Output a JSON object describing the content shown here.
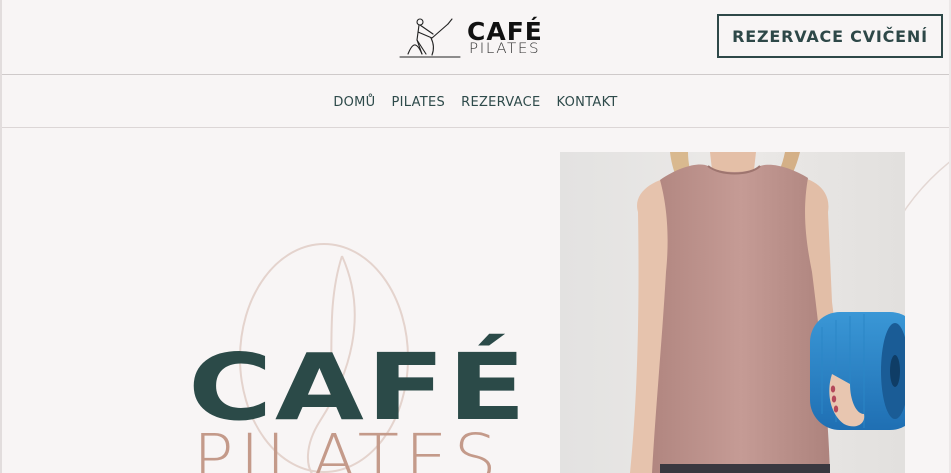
{
  "brand": {
    "name_line1": "CAFÉ",
    "name_line2": "PILATES"
  },
  "header": {
    "cta_label": "REZERVACE CVIČENÍ"
  },
  "nav": {
    "items": [
      {
        "label": "DOMŮ"
      },
      {
        "label": "PILATES"
      },
      {
        "label": "REZERVACE"
      },
      {
        "label": "KONTAKT"
      }
    ]
  },
  "hero": {
    "title_line1": "CAFÉ",
    "title_line2": "PILATES",
    "image_icon": "woman-holding-yoga-mat-photo"
  },
  "colors": {
    "accent": "#2e4848",
    "rose": "#c49a8a",
    "background": "#f8f5f5"
  }
}
